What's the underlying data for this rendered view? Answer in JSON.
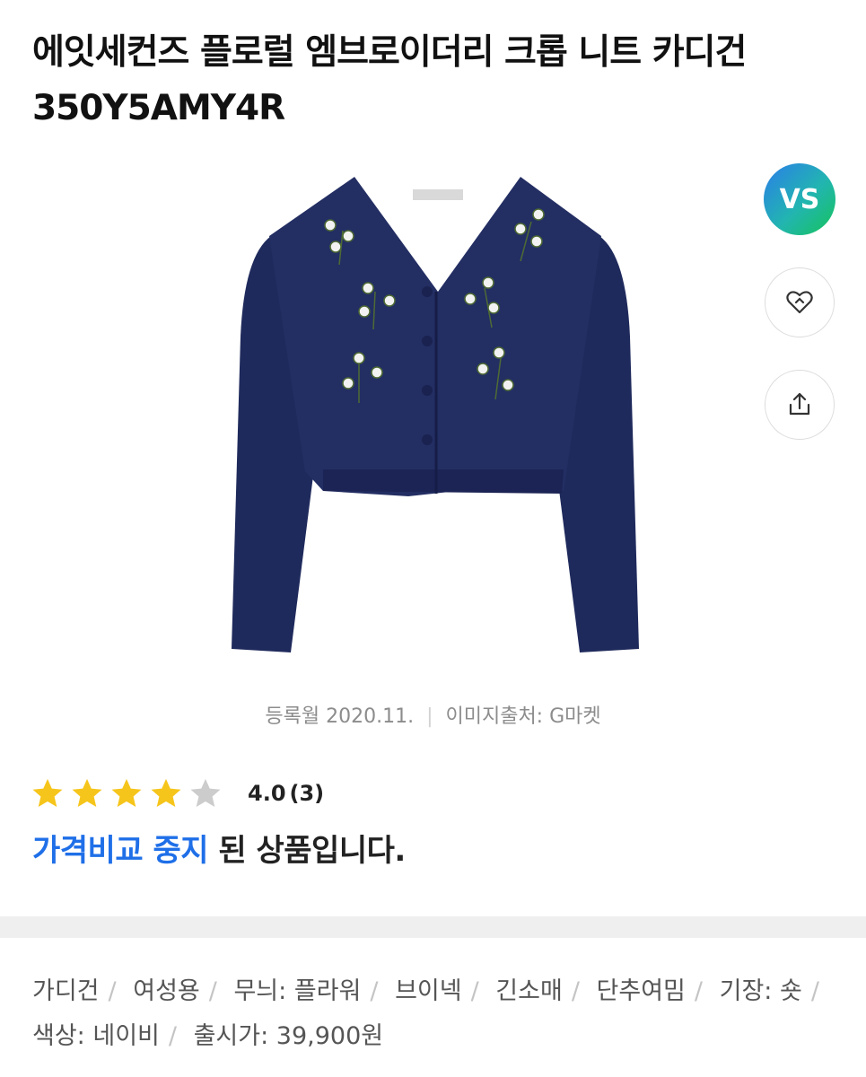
{
  "product": {
    "title": "에잇세컨즈 플로럴 엠브로이더리 크롭 니트 카디건 350Y5AMY4R",
    "image_alt": "navy cropped knit cardigan with floral embroidery"
  },
  "side_actions": {
    "badge_label": "VS",
    "wishlist_icon": "heart-tag-icon",
    "share_icon": "share-icon"
  },
  "meta": {
    "registered": "등록월 2020.11.",
    "image_source": "이미지출처: G마켓"
  },
  "rating": {
    "score": "4.0",
    "count": "(3)",
    "stars_filled": 4,
    "stars_total": 5,
    "star_color": "#f6c51b",
    "star_empty_color": "#cccccc"
  },
  "status": {
    "highlight": "가격비교 중지",
    "rest": " 된 상품입니다.",
    "highlight_color": "#1f6fe8"
  },
  "specs": [
    "가디건",
    "여성용",
    "무늬: 플라워",
    "브이넥",
    "긴소매",
    "단추여밈",
    "기장: 숏",
    "색상: 네이비",
    "출시가: 39,900원"
  ]
}
